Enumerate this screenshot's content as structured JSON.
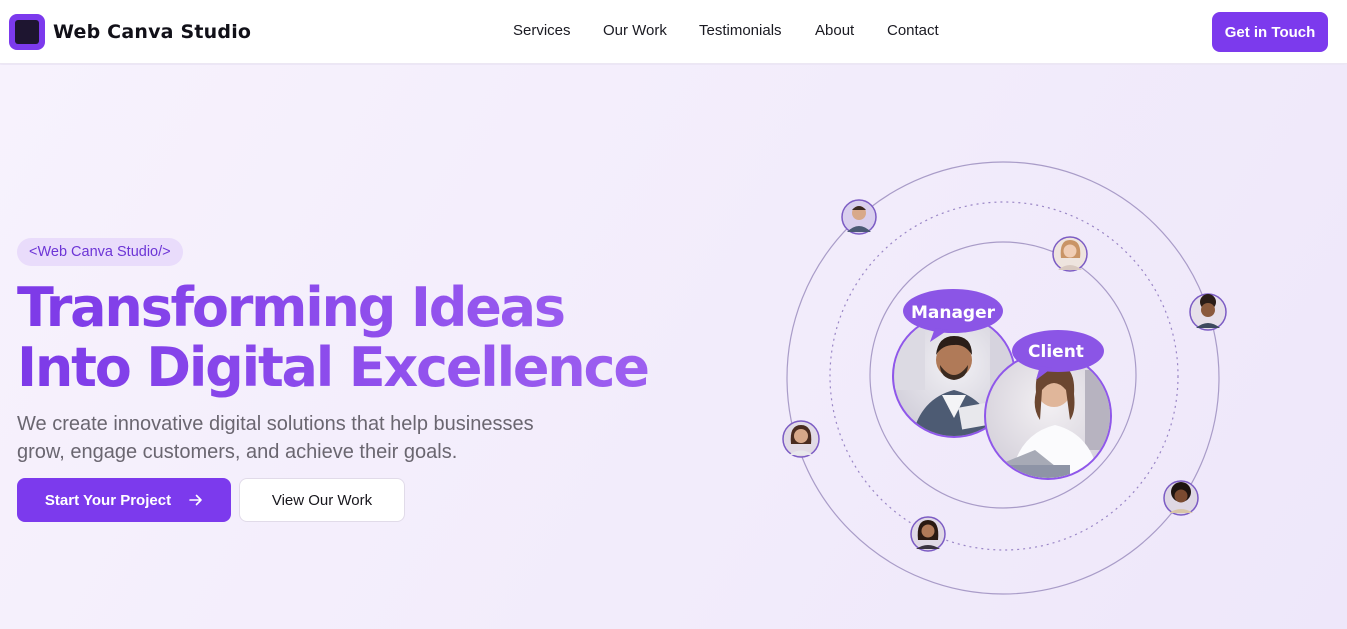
{
  "header": {
    "brand": "Web Canva Studio",
    "nav": [
      "Services",
      "Our Work",
      "Testimonials",
      "About",
      "Contact"
    ],
    "cta_label": "Get in Touch"
  },
  "hero": {
    "badge": "<Web Canva Studio/>",
    "headline_line1": "Transforming Ideas",
    "headline_line2": "Into Digital Excellence",
    "subtext_line1": "We create innovative digital solutions that help businesses",
    "subtext_line2": "grow, engage customers, and achieve their goals.",
    "primary_button": "Start Your Project",
    "secondary_button": "View Our Work"
  },
  "illustration": {
    "manager_label": "Manager",
    "client_label": "Client"
  },
  "colors": {
    "accent": "#7c3aed",
    "headline_gradient_start": "#7d3ae8",
    "headline_gradient_end": "#9d5ff0",
    "background": "#f3eefb"
  }
}
